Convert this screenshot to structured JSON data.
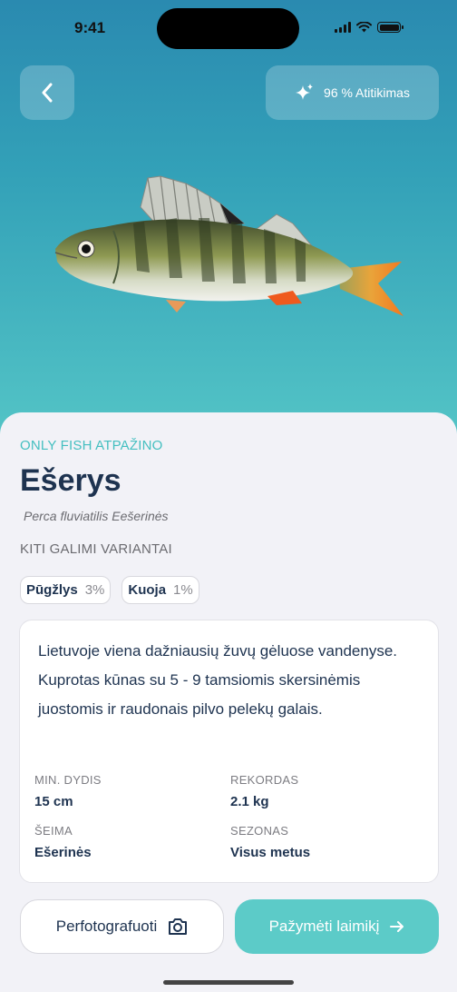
{
  "status": {
    "time": "9:41"
  },
  "header": {
    "match_label": "96 % Atitikimas"
  },
  "fish": {
    "eyebrow": "ONLY FISH ATPAŽINO",
    "name": "Ešerys",
    "latin": "Perca fluviatilis Eešerinės"
  },
  "alternatives": {
    "heading": "KITI GALIMI VARIANTAI",
    "items": [
      {
        "name": "Pūgžlys",
        "pct": "3%"
      },
      {
        "name": "Kuoja",
        "pct": "1%"
      }
    ]
  },
  "details": {
    "description": "Lietuvoje viena dažniausių žuvų gėluose vandenyse. Kuprotas kūnas su 5 - 9 tamsiomis skersinėmis juostomis ir raudonais pilvo pelekų galais.",
    "facts": [
      {
        "label": "MIN. DYDIS",
        "value": "15 cm"
      },
      {
        "label": "REKORDAS",
        "value": "2.1 kg"
      },
      {
        "label": "ŠEIMA",
        "value": "Ešerinės"
      },
      {
        "label": "SEZONAS",
        "value": "Visus metus"
      }
    ]
  },
  "actions": {
    "rephotograph_label": "Perfotografuoti",
    "mark_catch_label": "Pažymėti laimikį"
  },
  "icons": {
    "back": "chevron-left-icon",
    "match": "sparkles-icon",
    "camera": "camera-icon",
    "arrow": "arrow-right-icon"
  },
  "colors": {
    "accent": "#5ccbc8",
    "eyebrow": "#44bfc0",
    "title": "#1e3350",
    "hero_top": "#2a8ab0",
    "hero_bottom": "#53c4c6"
  }
}
